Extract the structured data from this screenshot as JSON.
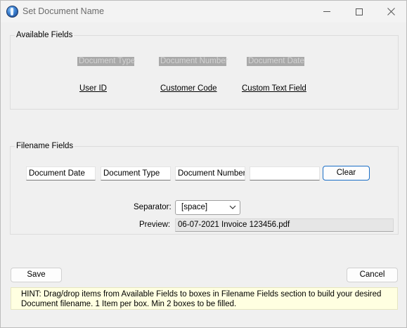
{
  "window": {
    "title": "Set Document Name",
    "icon": "app-globe-icon"
  },
  "available_fields": {
    "legend": "Available Fields",
    "disabled_fields": [
      "Document Type",
      "Document Number",
      "Document Date"
    ],
    "links": [
      "User ID",
      "Customer Code",
      "Custom Text Field"
    ]
  },
  "filename_fields": {
    "legend": "Filename Fields",
    "boxes": [
      "Document Date",
      "Document Type",
      "Document Number",
      ""
    ],
    "clear_label": "Clear",
    "separator_label": "Separator:",
    "separator_value": "[space]",
    "preview_label": "Preview:",
    "preview_value": "06-07-2021 Invoice 123456.pdf"
  },
  "actions": {
    "save_label": "Save",
    "cancel_label": "Cancel"
  },
  "hint": "HINT: Drag/drop items from Available Fields to boxes in Filename Fields section to build your desired Document filename. 1 Item per box. Min 2 boxes to be filled.",
  "colors": {
    "accent_border": "#1a6ec6",
    "hint_background": "#ffffe1",
    "disabled_field_background": "#a9a9a9"
  }
}
